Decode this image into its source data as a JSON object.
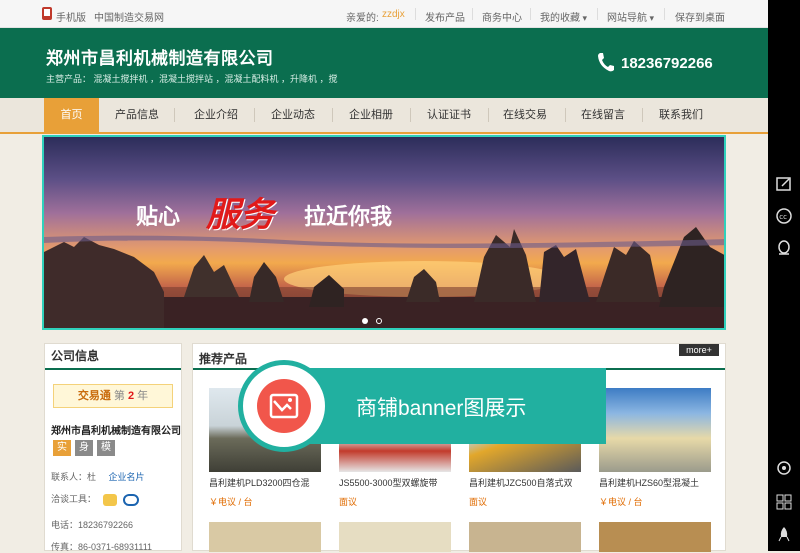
{
  "topbar": {
    "mobile_label": "手机版",
    "site_label": "中国制造交易网",
    "greeting": "亲爱的:",
    "username": "zzdjx",
    "publish": "发布产品",
    "business_center": "商务中心",
    "favorites": "我的收藏",
    "site_nav": "网站导航",
    "save_desktop": "保存到桌面"
  },
  "header": {
    "company_name": "郑州市昌利机械制造有限公司",
    "main_products": "主营产品：  混凝土搅拌机  ，混凝土搅拌站  ，混凝土配料机  ，升降机  ，搅",
    "phone": "18236792266"
  },
  "nav": {
    "items": [
      "首页",
      "产品信息",
      "企业介绍",
      "企业动态",
      "企业相册",
      "认证证书",
      "在线交易",
      "在线留言",
      "联系我们"
    ]
  },
  "banner": {
    "slogan_1": "贴心",
    "slogan_2": "服务",
    "slogan_3": "拉近你我"
  },
  "sidebar": {
    "title": "公司信息",
    "badge_prefix": "交易通",
    "badge_mid": "第",
    "badge_years": "2",
    "badge_suffix": "年",
    "company_name": "郑州市昌利机械制造有限公司",
    "chips": [
      "实",
      "身",
      "模"
    ],
    "contact_label": "联系人：",
    "contact_name": "杜",
    "card_link": "企业名片",
    "chat_label": "洽谈工具：",
    "tel": "电话：18236792266",
    "fax": "传真：86-0371-68931111"
  },
  "products": {
    "title": "推荐产品",
    "more": "more+",
    "items": [
      {
        "name": "昌利建机PLD3200四仓混",
        "price": "￥电议 / 台"
      },
      {
        "name": "JS5500-3000型双螺旋带",
        "price": "面议"
      },
      {
        "name": "昌利建机JZC500自落式双",
        "price": "面议"
      },
      {
        "name": "昌利建机HZS60型混凝土",
        "price": "￥电议 / 台"
      }
    ]
  },
  "overlay": {
    "label": "商铺banner图展示"
  },
  "colors": {
    "brand_green": "#0b6e4f",
    "nav_active": "#e8a038",
    "overlay_teal": "#21b0a0",
    "overlay_icon_red": "#f1564b"
  }
}
